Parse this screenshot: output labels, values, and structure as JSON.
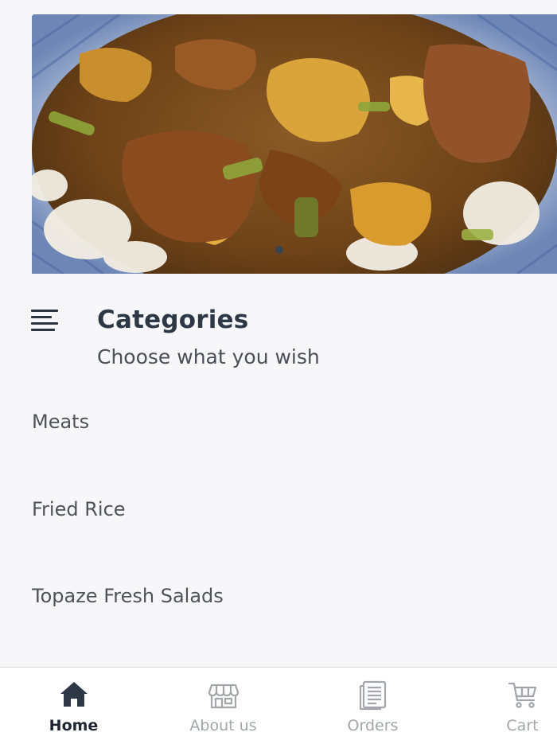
{
  "banner": {
    "image": "curry-chicken-potato-rice-dish",
    "carousel_active_index": 0
  },
  "categories": {
    "menu_icon": "menu-lines-icon",
    "title": "Categories",
    "subtitle": "Choose what you wish",
    "items": [
      {
        "label": "Meats"
      },
      {
        "label": "Fried Rice"
      },
      {
        "label": "Topaze Fresh Salads"
      }
    ]
  },
  "bottom_nav": {
    "items": [
      {
        "label": "Home",
        "icon": "home-icon",
        "active": true
      },
      {
        "label": "About us",
        "icon": "store-icon",
        "active": false
      },
      {
        "label": "Orders",
        "icon": "orders-icon",
        "active": false
      },
      {
        "label": "Cart",
        "icon": "cart-icon",
        "active": false
      }
    ],
    "active_color": "#2d3746",
    "inactive_color": "#a3a5aa"
  }
}
